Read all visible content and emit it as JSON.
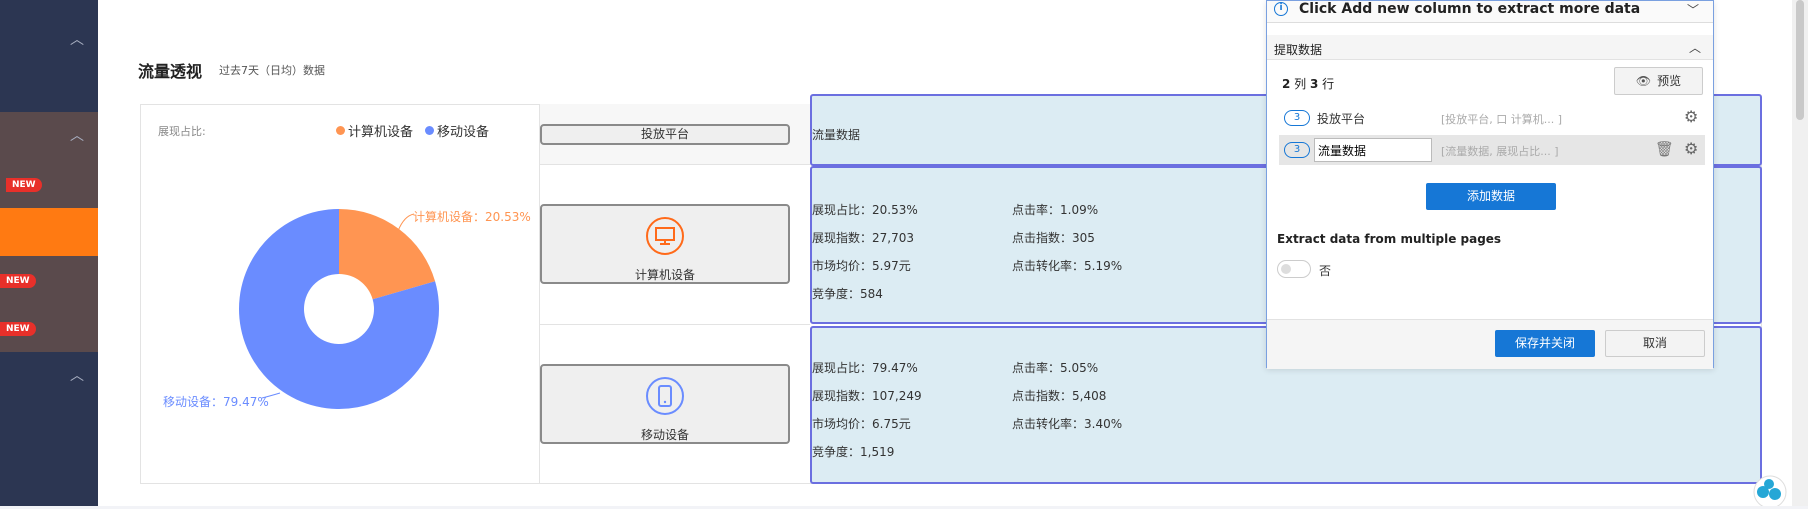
{
  "section": {
    "title": "流量透视",
    "subtitle": "过去7天（日均）数据"
  },
  "pie": {
    "label": "展现占比:",
    "legend": [
      {
        "name": "计算机设备",
        "color": "#ff9552"
      },
      {
        "name": "移动设备",
        "color": "#6a8cff"
      }
    ],
    "callouts": [
      "计算机设备：20.53%",
      "移动设备：79.47%"
    ]
  },
  "chart_data": {
    "type": "pie",
    "donut": true,
    "categories": [
      "计算机设备",
      "移动设备"
    ],
    "values": [
      20.53,
      79.47
    ],
    "colors": [
      "#ff9552",
      "#6a8cff"
    ],
    "ylabel": "展现占比"
  },
  "table": {
    "header_platform": "投放平台",
    "header_data": "流量数据",
    "rows": [
      {
        "platform": "计算机设备",
        "icon": "computer-icon",
        "col1": [
          "展现占比：20.53%",
          "展现指数：27,703",
          "市场均价：5.97元",
          "竞争度：584"
        ],
        "col2": [
          "点击率：1.09%",
          "点击指数：305",
          "点击转化率：5.19%"
        ]
      },
      {
        "platform": "移动设备",
        "icon": "mobile-icon",
        "col1": [
          "展现占比：79.47%",
          "展现指数：107,249",
          "市场均价：6.75元",
          "竞争度：1,519"
        ],
        "col2": [
          "点击率：5.05%",
          "点击指数：5,408",
          "点击转化率：3.40%"
        ]
      }
    ]
  },
  "sidebar": {
    "badges": [
      "NEW",
      "NEW",
      "NEW"
    ]
  },
  "panel": {
    "banner": "Click Add new column to extract more data",
    "section_title": "提取数据",
    "summary_bold1": "2",
    "summary_text1": " 列 ",
    "summary_bold2": "3",
    "summary_text2": " 行",
    "preview_label": "预览",
    "fields": [
      {
        "count": "3",
        "name": "投放平台",
        "preview": "[投放平台, 口 计算机... ]"
      },
      {
        "count": "3",
        "name": "流量数据",
        "preview": "[流量数据, 展现占比... ]"
      }
    ],
    "add_button": "添加数据",
    "multi_page_label": "Extract data from multiple pages",
    "toggle_text": "否",
    "save_button": "保存并关闭",
    "cancel_button": "取消",
    "colors": {
      "primary": "#1677d6",
      "border": "#7aa0e0"
    }
  }
}
